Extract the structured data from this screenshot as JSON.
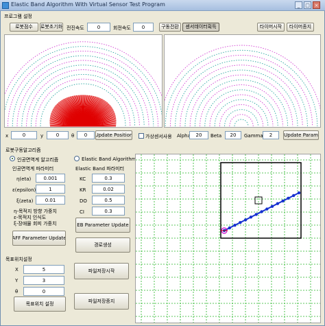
{
  "window": {
    "title": "Elastic Band Algorithm With Virtual Sensor Test Program"
  },
  "menu": {
    "label": "프로그램 설정"
  },
  "toolbar": {
    "robot_label": "로봇점수",
    "init_button": "로봇초기화",
    "speed_label": "전진속도",
    "speed_value": "0",
    "turn_label": "회전속도",
    "turn_value": "0",
    "mode_button": "구동전환",
    "sensor_button": "센서데이터획득",
    "timer_start": "타이머시작",
    "timer_stop": "타이머종지"
  },
  "position": {
    "x_label": "x",
    "x_value": "0",
    "y_label": "y",
    "y_value": "0",
    "theta_label": "θ",
    "theta_value": "0",
    "update_button": "Update Position"
  },
  "params": {
    "checkbox_label": "가상센서사용",
    "alpha_label": "Alpha",
    "alpha_value": "20",
    "beta_label": "Beta",
    "beta_value": "20",
    "gamma_label": "Gamma",
    "gamma_value": "2",
    "update_button": "Update Param"
  },
  "algo": {
    "group_label": "로봇구동알고리즘",
    "radio1_label": "인공면역계 알고리즘",
    "radio2_label": "Elastic Band Algorithm",
    "aff_title": "인공면역계 파라미터",
    "eta_label": "η(eta)",
    "eta_value": "0.001",
    "epsilon_label": "ε(epsilon)",
    "epsilon_value": "1",
    "zeta_label": "ξ(zeta)",
    "zeta_value": "0.01",
    "note_line1": "η-목적지 방향 가중치",
    "note_line2": "ε-목적지 인식도",
    "note_line3": "ξ-장애물 회피 가중치",
    "aff_button": "AFF Parameter Update",
    "eb_title": "Elastic Band 파라미터",
    "kc_label": "KC",
    "kc_value": "0.3",
    "kr_label": "KR",
    "kr_value": "0.02",
    "do_label": "DO",
    "do_value": "0.5",
    "ci_label": "CI",
    "ci_value": "0.3",
    "eb_button": "EB Parameter Update",
    "hold_button": "경로생성"
  },
  "target": {
    "group_label": "목표위치설정",
    "x_label": "X",
    "x_value": "5",
    "y_label": "Y",
    "y_value": "3",
    "theta_label": "θ",
    "theta_value": "0",
    "set_button": "목표위치 설정",
    "save_button": "파일저장시작",
    "stop_button": "파일저장종지"
  },
  "colors": {
    "sensor_red": "#e00000",
    "arc_teal": "#2aa6a0",
    "arc_magenta": "#d23cd2",
    "grid_green": "#22b522",
    "path_blue": "#1530d0"
  },
  "icons": {
    "title": "app-icon",
    "min": "minimize-icon",
    "max": "maximize-icon",
    "close": "close-icon"
  }
}
